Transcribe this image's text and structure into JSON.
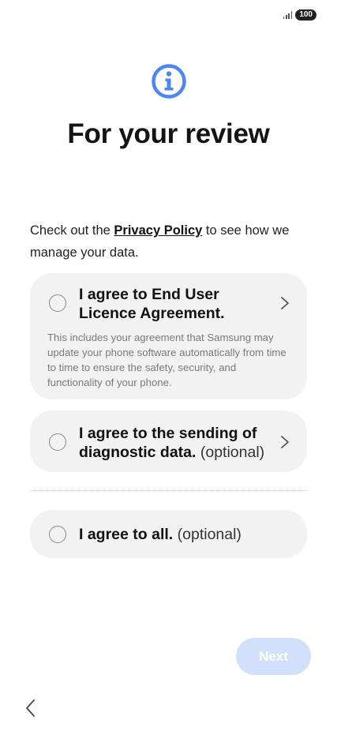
{
  "status_bar": {
    "battery": "100",
    "signal_bars": 4
  },
  "header": {
    "icon": "info-icon",
    "title": "For your review",
    "accent_color": "#4f86f0"
  },
  "intro": {
    "before": "Check out the ",
    "link": "Privacy Policy",
    "after": " to see how we manage your data."
  },
  "options": [
    {
      "label": "I agree to End User Licence Agreement.",
      "description": "This includes your agreement that Samsung may update your phone software automatically from time to time to ensure the safety, security, and functionality of your phone.",
      "checked": false
    },
    {
      "label": "I agree to the sending of diagnostic data.",
      "suffix": " (optional)",
      "checked": false
    },
    {
      "label": "I agree to all.",
      "suffix": " (optional)",
      "checked": false
    }
  ],
  "footer": {
    "next_label": "Next",
    "back_icon": "chevron-left-icon",
    "next_enabled": false
  }
}
